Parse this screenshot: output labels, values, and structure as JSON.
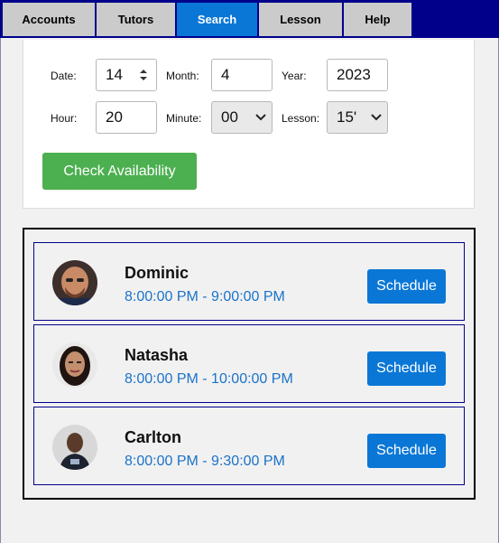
{
  "nav": {
    "tabs": [
      {
        "label": "Accounts"
      },
      {
        "label": "Tutors"
      },
      {
        "label": "Search"
      },
      {
        "label": "Lesson"
      },
      {
        "label": "Help"
      }
    ],
    "active": "Search"
  },
  "search": {
    "date_label": "Date:",
    "date_value": "14",
    "month_label": "Month:",
    "month_value": "4",
    "year_label": "Year:",
    "year_value": "2023",
    "hour_label": "Hour:",
    "hour_value": "20",
    "minute_label": "Minute:",
    "minute_value": "00",
    "lesson_label": "Lesson:",
    "lesson_value": "15'",
    "check_label": "Check Availability"
  },
  "results": [
    {
      "name": "Dominic",
      "time": "8:00:00 PM - 9:00:00 PM",
      "button": "Schedule"
    },
    {
      "name": "Natasha",
      "time": "8:00:00 PM - 10:00:00 PM",
      "button": "Schedule"
    },
    {
      "name": "Carlton",
      "time": "8:00:00 PM - 9:30:00 PM",
      "button": "Schedule"
    }
  ],
  "colors": {
    "nav_bg": "#00008b",
    "active_tab": "#0a77d6",
    "check_button": "#4caf50",
    "schedule_button": "#0a77d6",
    "time_text": "#1a73c9"
  }
}
